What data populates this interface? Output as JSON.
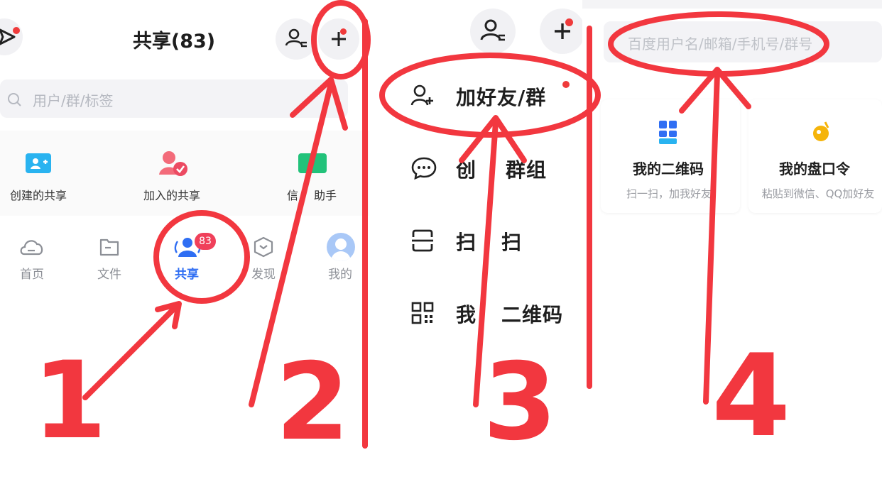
{
  "panel1": {
    "title": "共享(83)",
    "search_placeholder": "用户/群/标签",
    "shortcuts": [
      "创建的共享",
      "加入的共享",
      "信息助手"
    ],
    "shortcut_partial": "信",
    "shortcut_partial_end": "助手",
    "tabs": [
      "首页",
      "文件",
      "共享",
      "发现",
      "我的"
    ],
    "share_badge": "83",
    "active_tab": "共享"
  },
  "panel2": {
    "menu": [
      "加好友/群",
      "创建群组",
      "扫一扫",
      "我的二维码"
    ],
    "menu_visible": {
      "create_group": "创",
      "create_group_end": "群组",
      "scan_start": "扫",
      "scan_end": "扫",
      "qr_start": "我",
      "qr_end": "二维码"
    }
  },
  "panel3": {
    "search_placeholder": "百度用户名/邮箱/手机号/群号",
    "cards": [
      {
        "title": "我的二维码",
        "subtitle": "扫一扫，加我好友"
      },
      {
        "title": "我的盘口令",
        "subtitle": "粘贴到微信、QQ加好友"
      }
    ]
  },
  "annotations": {
    "step_numbers": [
      "1",
      "2",
      "3",
      "4"
    ],
    "color": "#f2373f"
  },
  "colors": {
    "accent": "#2f6ef3",
    "badge": "#f0405a",
    "annotation": "#f2373f"
  }
}
